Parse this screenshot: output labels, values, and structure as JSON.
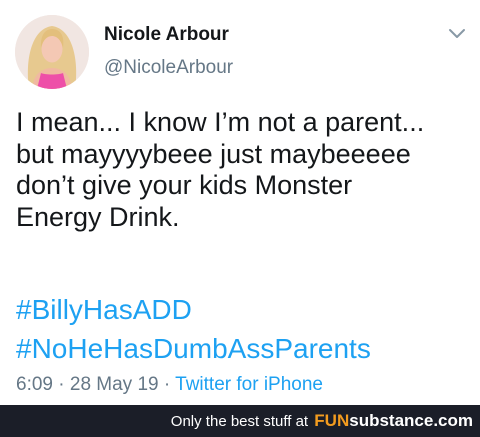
{
  "tweet": {
    "author_name": "Nicole Arbour",
    "author_handle": "@NicoleArbour",
    "text_lines": [
      "I mean... I know I’m not a parent...",
      "but mayyyybeee just maybeeeee",
      "don’t give your kids Monster",
      "Energy Drink."
    ],
    "hashtags": [
      "#BillyHasADD",
      "#NoHeHasDumbAssParents"
    ],
    "time": "6:09",
    "date": "28 May 19",
    "separator": " · ",
    "source": "Twitter for iPhone",
    "icons": {
      "menu": "chevron-down-icon",
      "avatar": "profile-photo"
    }
  },
  "footer": {
    "tagline": "Only the best stuff at",
    "brand_part1": "FUN",
    "brand_part2": "substance.com"
  },
  "colors": {
    "link": "#1da1f2",
    "secondary_text": "#657786",
    "primary_text": "#14171a",
    "footer_bg": "#1b1e28",
    "brand_orange": "#f39c1f"
  }
}
